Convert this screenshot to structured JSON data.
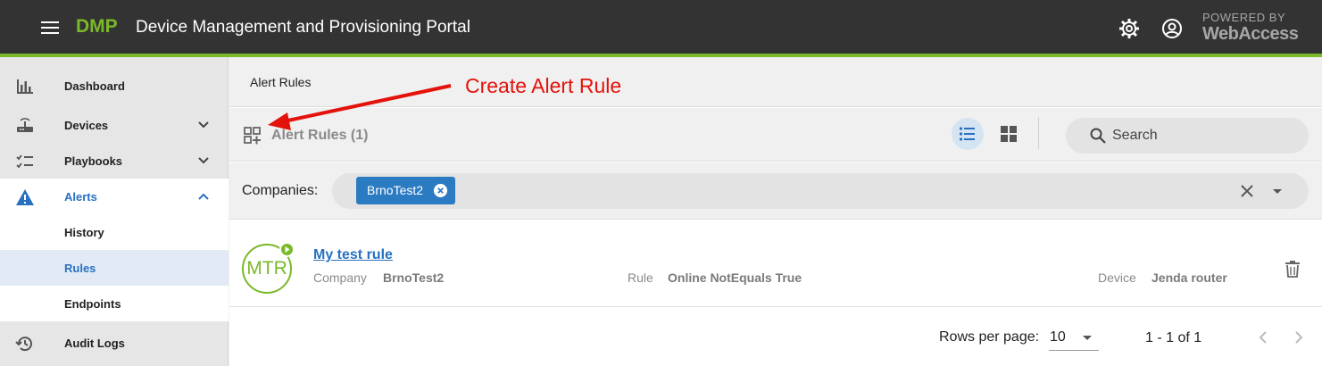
{
  "header": {
    "brand": "DMP",
    "title": "Device Management and Provisioning Portal",
    "powered_line1": "POWERED BY",
    "powered_line2": "WebAccess"
  },
  "sidebar": {
    "items": [
      {
        "label": "Dashboard",
        "icon": "bar-chart-icon"
      },
      {
        "label": "Devices",
        "icon": "router-icon"
      },
      {
        "label": "Playbooks",
        "icon": "checklist-icon"
      },
      {
        "label": "Alerts",
        "icon": "warning-icon",
        "expanded": true
      },
      {
        "label": "History"
      },
      {
        "label": "Rules",
        "active": true
      },
      {
        "label": "Endpoints"
      },
      {
        "label": "Audit Logs",
        "icon": "history-icon"
      }
    ]
  },
  "breadcrumb": "Alert Rules",
  "annotation": "Create Alert Rule",
  "toolbar": {
    "title": "Alert Rules (1)",
    "search_placeholder": "Search"
  },
  "filter": {
    "label": "Companies:",
    "chip": "BrnoTest2"
  },
  "rule": {
    "initials": "MTR",
    "name": "My test rule",
    "company_key": "Company",
    "company_value": "BrnoTest2",
    "rule_key": "Rule",
    "rule_value": "Online NotEquals True",
    "device_key": "Device",
    "device_value": "Jenda router"
  },
  "pager": {
    "rows_label": "Rows per page:",
    "rows_value": "10",
    "range": "1 - 1 of 1"
  },
  "colors": {
    "accent_green": "#7ab929",
    "accent_blue": "#2871c0",
    "annotation_red": "#e3120b",
    "topbar": "#333333"
  }
}
